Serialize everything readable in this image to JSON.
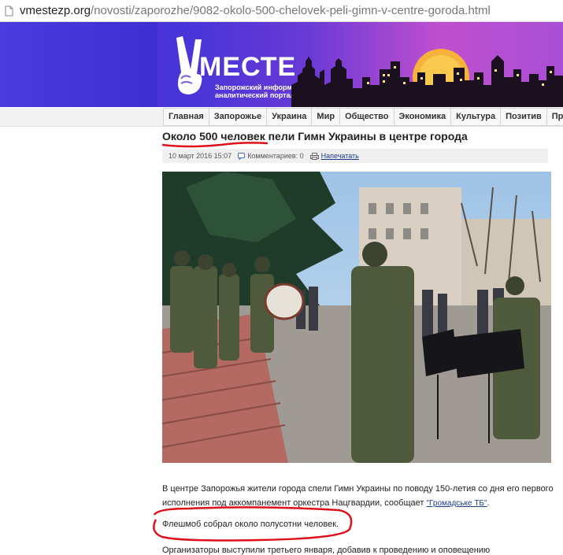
{
  "browser": {
    "url_host": "vmestezp.org",
    "url_path": "/novosti/zaporozhe/9082-okolo-500-chelovek-peli-gimn-v-centre-goroda.html"
  },
  "header": {
    "brand": "МЕСТЕ",
    "tagline": "Запорожский информационно-аналитический портал"
  },
  "nav": {
    "items": [
      "Главная",
      "Запорожье",
      "Украина",
      "Мир",
      "Общество",
      "Экономика",
      "Культура",
      "Позитив",
      "Пр"
    ]
  },
  "article": {
    "title": "Около 500 человек пели Гимн Украины в центре города",
    "date": "10 март 2016 15:07",
    "comments": "Комментариев: 0",
    "print": "Напечатать",
    "p1_line1": "В центре Запорожья жители города спели Гимн Украины по поводу 150-летия со дня его первого",
    "p1_line2": "исполнения под аккомпанемент оркестра Нацгвардии, сообщает ",
    "p1_link": "\"Громадське ТБ\"",
    "p1_end": ".",
    "p2": "Флешмоб собрал около полусотни человек.",
    "p3": "Организаторы выступили третьего января, добавив к проведению и оповещению"
  },
  "colors": {
    "banner_start": "#3c2fd3",
    "banner_end": "#c04fce",
    "annotation_red": "#e0101a",
    "link": "#1a3e8c"
  }
}
